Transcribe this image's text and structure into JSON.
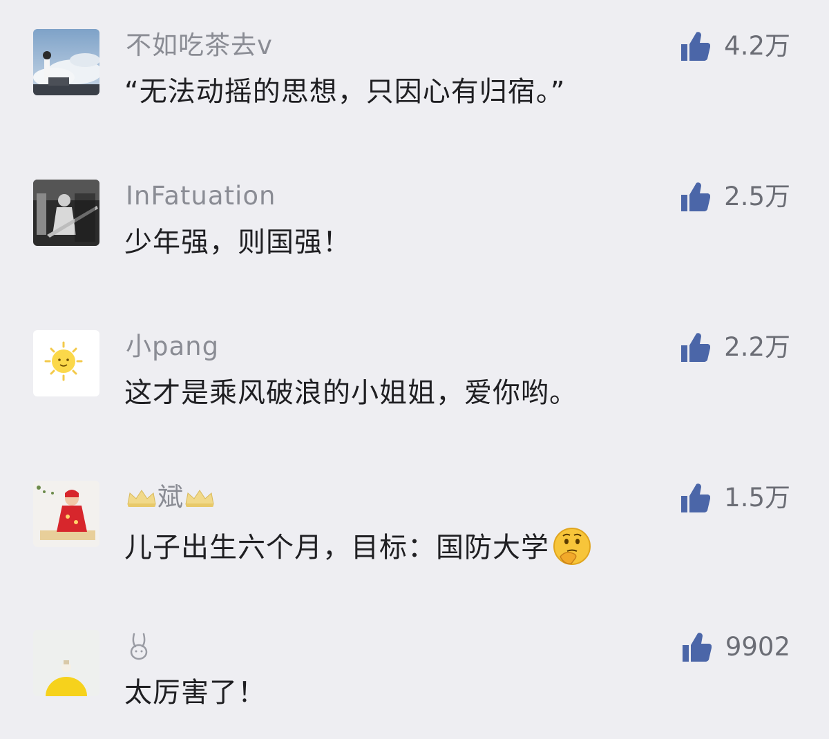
{
  "colors": {
    "background": "#eeeef2",
    "username": "#8a8c94",
    "text": "#1f1f22",
    "like_icon": "#4b66a8",
    "like_count": "#6b6d75"
  },
  "comments": [
    {
      "avatar_icon": "sky-clouds-avatar",
      "username": "不如吃茶去v",
      "text": "“无法动摇的思想，只因心有归宿。”",
      "likes": "4.2万"
    },
    {
      "avatar_icon": "guitarist-bw-avatar",
      "username": "InFatuation",
      "text": "少年强，则国强！",
      "likes": "2.5万"
    },
    {
      "avatar_icon": "sun-avatar",
      "username": "小pang",
      "text": "这才是乘风破浪的小姐姐，爱你哟。",
      "likes": "2.2万"
    },
    {
      "avatar_icon": "baby-avatar",
      "username": "斌",
      "username_decoration": "crown-icon",
      "text": "儿子出生六个月，目标：国防大学",
      "text_emoji": "thinking-face-emoji",
      "likes": "1.5万"
    },
    {
      "avatar_icon": "yellow-figure-avatar",
      "username": "",
      "username_decoration": "rabbit-icon",
      "text": "太厉害了！",
      "likes": "9902"
    }
  ]
}
